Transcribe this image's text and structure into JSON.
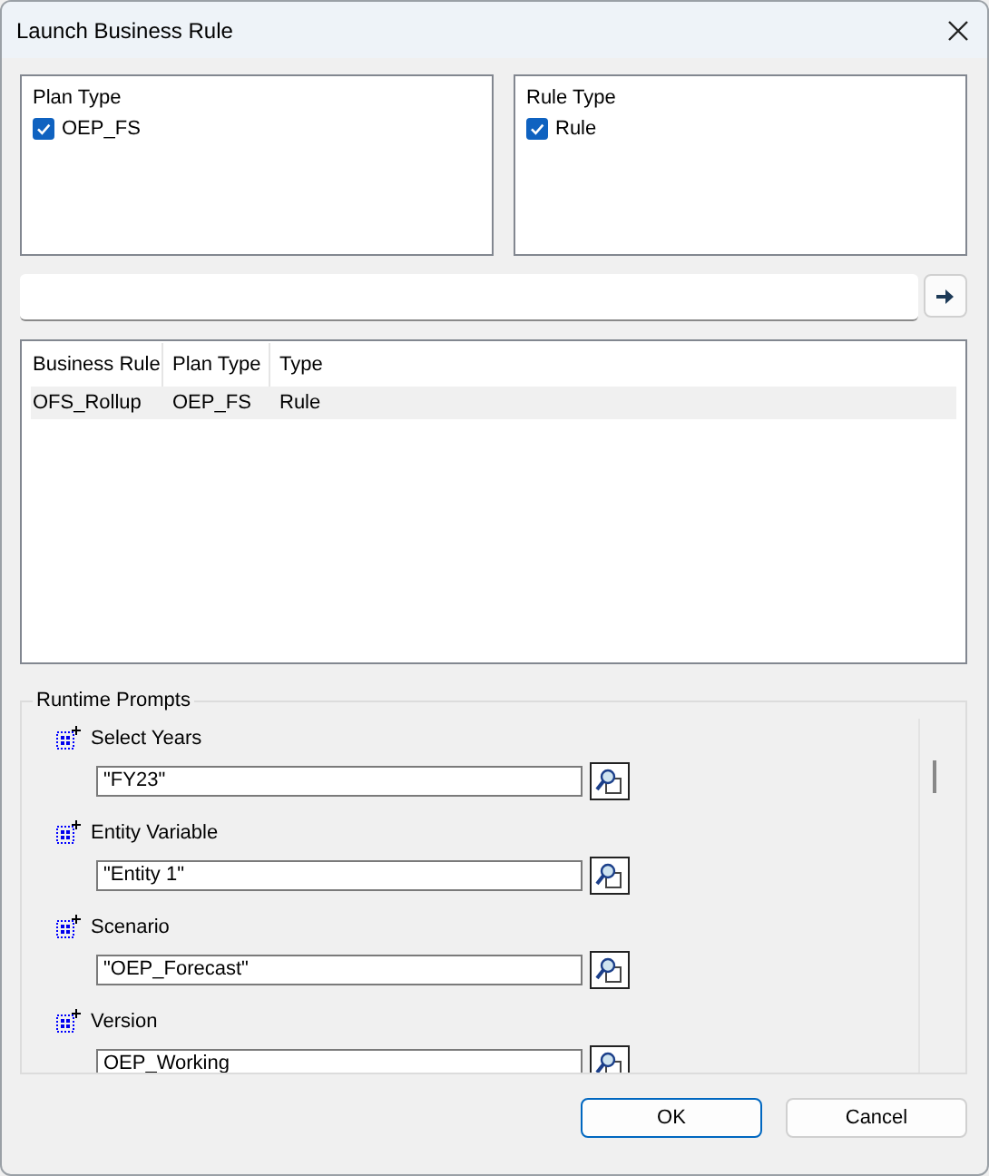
{
  "window": {
    "title": "Launch Business Rule"
  },
  "plan_type": {
    "label": "Plan Type",
    "items": [
      {
        "label": "OEP_FS",
        "checked": true
      }
    ]
  },
  "rule_type": {
    "label": "Rule Type",
    "items": [
      {
        "label": "Rule",
        "checked": true
      }
    ]
  },
  "table": {
    "columns": [
      "Business Rule",
      "Plan Type",
      "Type"
    ],
    "rows": [
      {
        "cells": [
          "OFS_Rollup",
          "OEP_FS",
          "Rule"
        ],
        "selected": true
      }
    ]
  },
  "runtime_prompts": {
    "label": "Runtime Prompts",
    "prompts": [
      {
        "label": "Select Years",
        "value": "\"FY23\""
      },
      {
        "label": "Entity Variable",
        "value": "\"Entity 1\""
      },
      {
        "label": "Scenario",
        "value": "\"OEP_Forecast\""
      },
      {
        "label": "Version",
        "value": "OEP_Working"
      }
    ]
  },
  "buttons": [
    {
      "label": "OK",
      "kind": "default"
    },
    {
      "label": "Cancel",
      "kind": "normal"
    }
  ]
}
